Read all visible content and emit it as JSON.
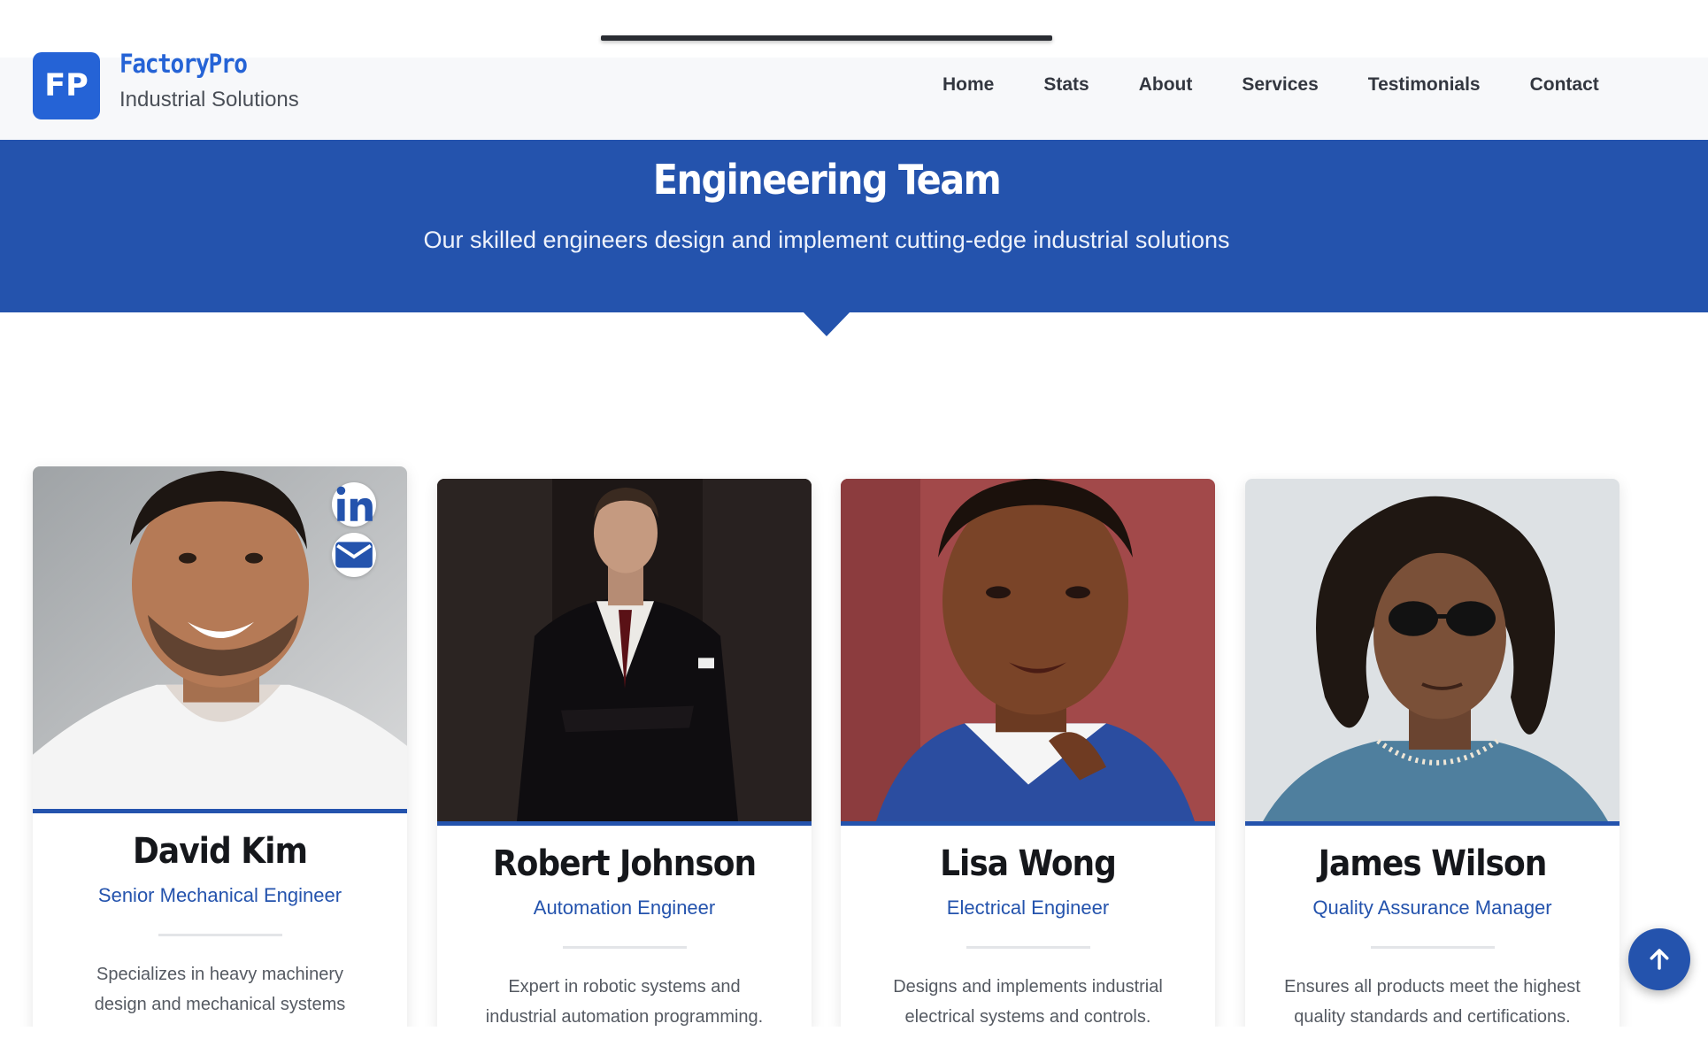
{
  "brand": {
    "logo_text": "FP",
    "name": "FactoryPro",
    "tagline": "Industrial Solutions"
  },
  "nav": {
    "items": [
      "Home",
      "Stats",
      "About",
      "Services",
      "Testimonials",
      "Contact"
    ]
  },
  "hero": {
    "title": "Engineering Team",
    "subtitle": "Our skilled engineers design and implement cutting-edge industrial solutions"
  },
  "team": [
    {
      "name": "David Kim",
      "role": "Senior Mechanical Engineer",
      "bio": "Specializes in heavy machinery design and mechanical systems integration."
    },
    {
      "name": "Robert Johnson",
      "role": "Automation Engineer",
      "bio": "Expert in robotic systems and industrial automation programming."
    },
    {
      "name": "Lisa Wong",
      "role": "Electrical Engineer",
      "bio": "Designs and implements industrial electrical systems and controls."
    },
    {
      "name": "James Wilson",
      "role": "Quality Assurance Manager",
      "bio": "Ensures all products meet the highest quality standards and certifications."
    }
  ],
  "social": {
    "linkedin_icon": "linkedin-icon",
    "email_icon": "envelope-icon"
  },
  "colors": {
    "primary": "#2453ad",
    "logo_blue": "#2563d6"
  }
}
